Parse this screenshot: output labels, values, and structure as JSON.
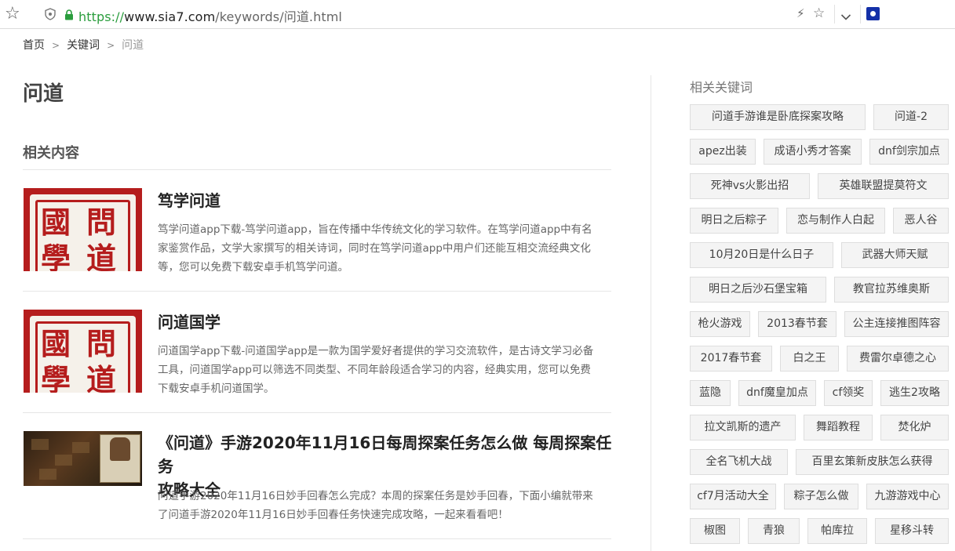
{
  "browser": {
    "url_scheme": "https://",
    "url_host": "www.sia7.com",
    "url_path": "/keywords/问道.html"
  },
  "breadcrumb": {
    "items": [
      "首页",
      "关键词",
      "问道"
    ]
  },
  "page": {
    "title": "问道",
    "section_title": "相关内容"
  },
  "articles": [
    {
      "title": "笃学问道",
      "desc_lines": [
        "笃学问道app下载-笃学问道app，旨在传播中华传统文化的学习软件。在笃学问道app中有名",
        "家鉴赏作品，文学大家撰写的相关诗词，同时在笃学问道app中用户们还能互相交流经典文化",
        "等，您可以免费下载安卓手机笃学问道。"
      ],
      "thumb_glyphs": [
        "國",
        "問",
        "學",
        "道"
      ]
    },
    {
      "title": "问道国学",
      "desc_lines": [
        "问道国学app下载-问道国学app是一款为国学爱好者提供的学习交流软件，是古诗文学习必备",
        "工具，问道国学app可以筛选不同类型、不同年龄段适合学习的内容，经典实用，您可以免费",
        "下载安卓手机问道国学。"
      ],
      "thumb_glyphs": [
        "國",
        "問",
        "學",
        "道"
      ]
    },
    {
      "title_lines": [
        "《问道》手游2020年11月16日每周探案任务怎么做 每周探案任务",
        "攻略大全"
      ],
      "desc_lines": [
        "问道手游2020年11月16日妙手回春怎么完成？本周的探案任务是妙手回春，下面小编就带来",
        "了问道手游2020年11月16日妙手回春任务快速完成攻略，一起来看看吧！"
      ]
    }
  ],
  "sidebar": {
    "title": "相关关键词",
    "tag_rows": [
      [
        "问道手游谁是卧底探案攻略",
        "问道-2"
      ],
      [
        "apez出装",
        "成语小秀才答案",
        "dnf剑宗加点"
      ],
      [
        "死神vs火影出招",
        "英雄联盟提莫符文"
      ],
      [
        "明日之后粽子",
        "恋与制作人白起",
        "恶人谷"
      ],
      [
        "10月20日是什么日子",
        "武器大师天赋"
      ],
      [
        "明日之后沙石堡宝箱",
        "教官拉苏维奥斯"
      ],
      [
        "枪火游戏",
        "2013春节套",
        "公主连接推图阵容"
      ],
      [
        "2017春节套",
        "白之王",
        "费雷尔卓德之心"
      ],
      [
        "蓝隐",
        "dnf魔皇加点",
        "cf领奖",
        "逃生2攻略"
      ],
      [
        "拉文凯斯的遗产",
        "舞蹈教程",
        "焚化炉"
      ],
      [
        "全名飞机大战",
        "百里玄策新皮肤怎么获得"
      ],
      [
        "cf7月活动大全",
        "粽子怎么做",
        "九游游戏中心"
      ],
      [
        "椒图",
        "青狼",
        "帕库拉",
        "星移斗转"
      ]
    ]
  }
}
